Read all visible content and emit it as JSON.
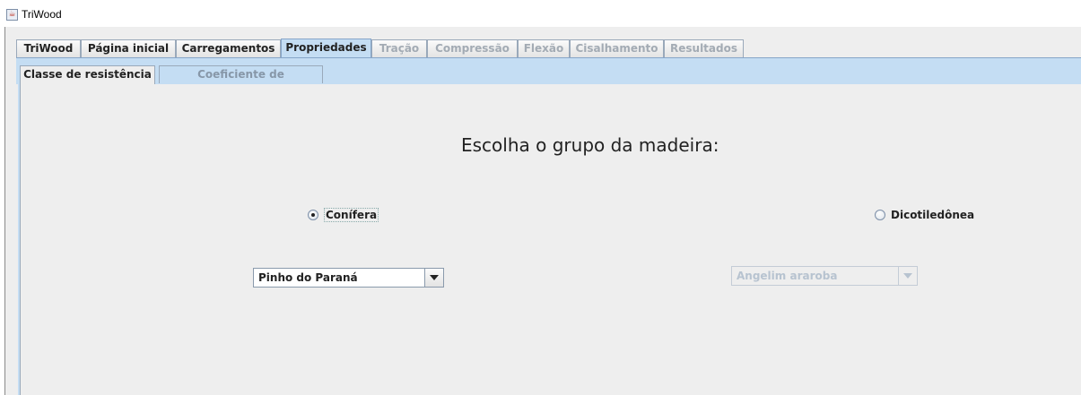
{
  "window": {
    "title": "TriWood"
  },
  "tabs": [
    {
      "label": "TriWood",
      "state": "normal"
    },
    {
      "label": "Página inicial",
      "state": "normal"
    },
    {
      "label": "Carregamentos",
      "state": "normal"
    },
    {
      "label": "Propriedades",
      "state": "active"
    },
    {
      "label": "Tração",
      "state": "disabled"
    },
    {
      "label": "Compressão",
      "state": "disabled"
    },
    {
      "label": "Flexão",
      "state": "disabled"
    },
    {
      "label": "Cisalhamento",
      "state": "disabled"
    },
    {
      "label": "Resultados",
      "state": "disabled"
    }
  ],
  "subtabs": [
    {
      "label": "Classe de resistência",
      "state": "active"
    },
    {
      "label": "Coeficiente de modificação",
      "state": "disabled"
    }
  ],
  "panel": {
    "heading": "Escolha o grupo da madeira:",
    "radio_conifera": {
      "label": "Conífera",
      "checked": true
    },
    "radio_dicotiledonea": {
      "label": "Dicotiledônea",
      "checked": false
    },
    "combo_conifera": {
      "value": "Pinho do Paraná",
      "enabled": true
    },
    "combo_dicotiledonea": {
      "value": "Angelim araroba",
      "enabled": false
    }
  },
  "colors": {
    "accent": "#c4ddf3",
    "panel_bg": "#eeeeee",
    "disabled_text": "#a3abb4"
  }
}
